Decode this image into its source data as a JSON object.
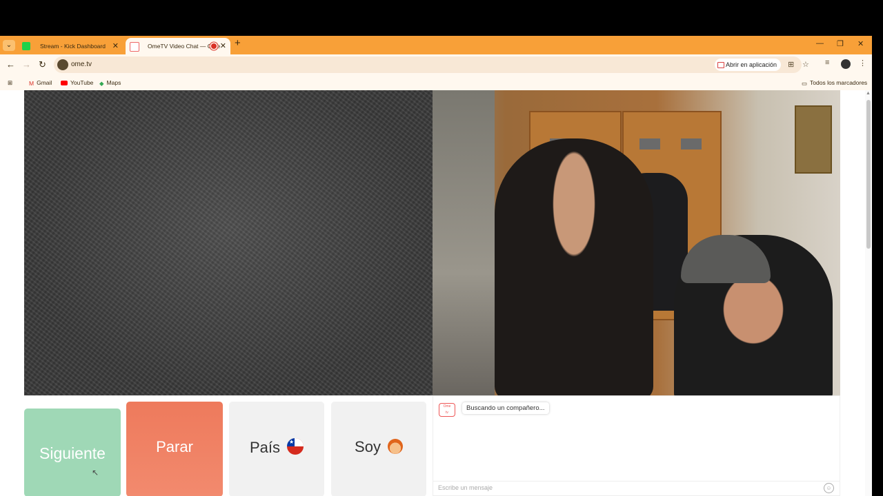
{
  "browser": {
    "tabs": [
      {
        "title": "Stream - Kick Dashboard",
        "favicon": "kick-icon",
        "active": false
      },
      {
        "title": "OmeTV Video Chat — Ome",
        "favicon": "ometv-icon",
        "active": true,
        "recording": true
      }
    ],
    "url": "ome.tv",
    "open_in_app": "Abrir en aplicación",
    "bookmarks": [
      {
        "label": "Gmail",
        "icon": "gmail-icon"
      },
      {
        "label": "YouTube",
        "icon": "youtube-icon"
      },
      {
        "label": "Maps",
        "icon": "maps-icon"
      }
    ],
    "all_bookmarks": "Todos los marcadores"
  },
  "controls": {
    "next": "Siguiente",
    "stop": "Parar",
    "country": "País",
    "country_flag": "chile-flag-icon",
    "me": "Soy",
    "me_icon": "boy-face-icon"
  },
  "chat": {
    "status": "Buscando un compañero...",
    "placeholder": "Escribe un mensaje"
  },
  "colors": {
    "tabstrip": "#f8a038",
    "next_button": "#9fd8b6",
    "stop_button": "#ee7a5c"
  }
}
